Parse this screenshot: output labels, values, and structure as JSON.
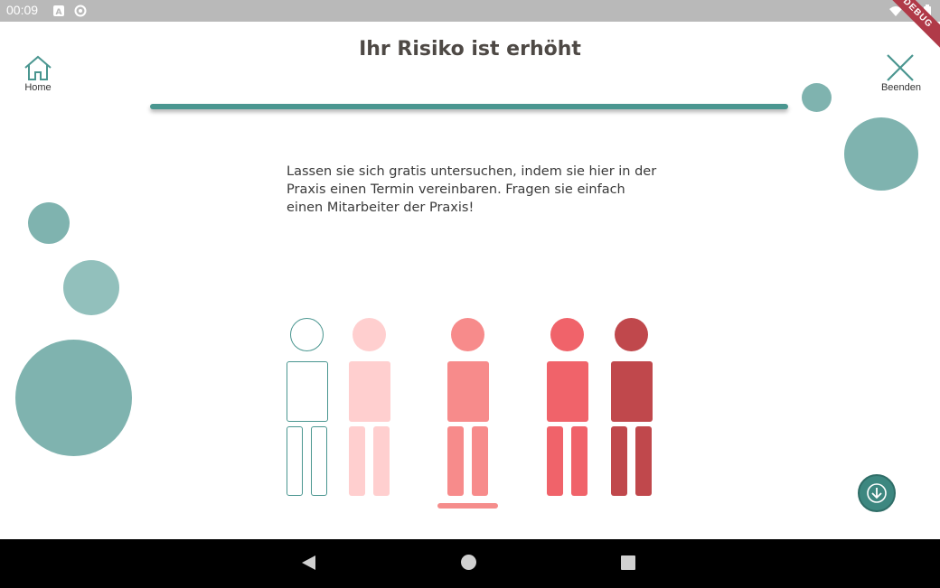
{
  "status_bar": {
    "time": "00:09",
    "debug_label": "DEBUG"
  },
  "header": {
    "title": "Ihr Risiko ist erhöht",
    "home_label": "Home",
    "end_label": "Beenden"
  },
  "progress": {
    "value": 1.0
  },
  "message": "Lassen sie sich gratis untersuchen, indem sie hier in der Praxis einen Termin vereinbaren. Fragen sie einfach einen Mitarbeiter der Praxis!",
  "risk_figures": [
    {
      "level": 1,
      "style": "outline",
      "color": "#4a9690"
    },
    {
      "level": 2,
      "style": "filled",
      "color": "#ffcfcf"
    },
    {
      "level": 3,
      "style": "filled",
      "color": "#f78b8b",
      "selected": true
    },
    {
      "level": 4,
      "style": "filled",
      "color": "#f0636a"
    },
    {
      "level": 5,
      "style": "filled",
      "color": "#c0484c"
    }
  ],
  "colors": {
    "accent": "#4a9690",
    "bubble": "#7fb3af",
    "title_text": "#4e4945",
    "selection_bar": "#f58d8c"
  },
  "icons": {
    "home": "home-icon",
    "close": "close-icon",
    "down": "arrow-down-icon"
  }
}
